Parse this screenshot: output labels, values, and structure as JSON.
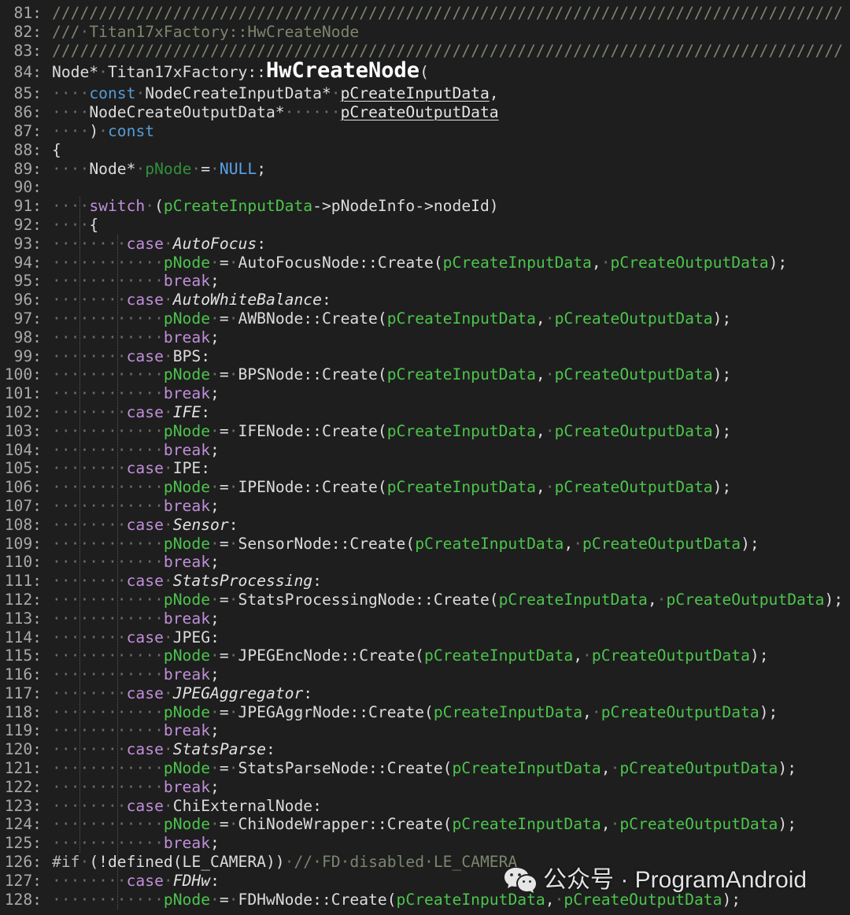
{
  "editor": {
    "syntax_colors": {
      "background": "#1e1e1e",
      "text": "#dcdcdc",
      "line_number": "#a9a9a9",
      "ws": "#6c6c6c",
      "comment": "#7a866e",
      "kw": "#569cd6",
      "ctl": "#c08fd8",
      "nul": "#5aa2ea",
      "txt": "#dcdcdc",
      "par": "#4cc44c",
      "loc": "#32903c",
      "enum": "#e2e2e2",
      "func": "#ffffff",
      "decl": "#e4e4e4",
      "pre": "#b8b8b8"
    },
    "lines": [
      {
        "n": "81:",
        "tokens": [
          {
            "comment": "/////////////////////////////////////////////////////////////////////////////////////"
          }
        ]
      },
      {
        "n": "82:",
        "tokens": [
          {
            "comment": "///"
          },
          {
            "ws": "·"
          },
          {
            "comment": "Titan17xFactory::HwCreateNode"
          }
        ]
      },
      {
        "n": "83:",
        "tokens": [
          {
            "comment": "/////////////////////////////////////////////////////////////////////////////////////"
          }
        ]
      },
      {
        "n": "84:",
        "tokens": [
          {
            "txt": "Node*"
          },
          {
            "ws": "·"
          },
          {
            "txt": "Titan17xFactory::"
          },
          {
            "func": "HwCreateNode"
          },
          {
            "txt": "("
          }
        ]
      },
      {
        "n": "85:",
        "tokens": [
          {
            "ws": "····"
          },
          {
            "kw": "const"
          },
          {
            "ws": "·"
          },
          {
            "txt": "NodeCreateInputData*"
          },
          {
            "ws": "·"
          },
          {
            "decl": "pCreateInputData"
          },
          {
            "txt": ","
          }
        ]
      },
      {
        "n": "86:",
        "tokens": [
          {
            "ws": "····"
          },
          {
            "txt": "NodeCreateOutputData*"
          },
          {
            "ws": "······"
          },
          {
            "decl": "pCreateOutputData"
          }
        ]
      },
      {
        "n": "87:",
        "tokens": [
          {
            "ws": "····"
          },
          {
            "txt": ")"
          },
          {
            "ws": "·"
          },
          {
            "kw": "const"
          }
        ]
      },
      {
        "n": "88:",
        "tokens": [
          {
            "txt": "{"
          }
        ]
      },
      {
        "n": "89:",
        "tokens": [
          {
            "ws": "····"
          },
          {
            "txt": "Node*"
          },
          {
            "ws": "·"
          },
          {
            "loc": "pNode"
          },
          {
            "ws": "·"
          },
          {
            "txt": "="
          },
          {
            "ws": "·"
          },
          {
            "nul": "NULL"
          },
          {
            "txt": ";"
          }
        ]
      },
      {
        "n": "90:",
        "tokens": []
      },
      {
        "n": "91:",
        "tokens": [
          {
            "ws": "····"
          },
          {
            "ctl": "switch"
          },
          {
            "ws": "·"
          },
          {
            "txt": "("
          },
          {
            "par": "pCreateInputData"
          },
          {
            "txt": "->pNodeInfo->nodeId)"
          }
        ]
      },
      {
        "n": "92:",
        "tokens": [
          {
            "ws": "····"
          },
          {
            "txt": "{"
          }
        ]
      },
      {
        "n": "93:",
        "tokens": [
          {
            "ws": "········"
          },
          {
            "ctl": "case"
          },
          {
            "ws": "·"
          },
          {
            "enum": "AutoFocus"
          },
          {
            "txt": ":"
          }
        ]
      },
      {
        "n": "94:",
        "tokens": [
          {
            "ws": "············"
          },
          {
            "par": "pNode"
          },
          {
            "ws": "·"
          },
          {
            "txt": "="
          },
          {
            "ws": "·"
          },
          {
            "txt": "AutoFocusNode::Create("
          },
          {
            "par": "pCreateInputData"
          },
          {
            "txt": ","
          },
          {
            "ws": "·"
          },
          {
            "par": "pCreateOutputData"
          },
          {
            "txt": ");"
          }
        ]
      },
      {
        "n": "95:",
        "tokens": [
          {
            "ws": "············"
          },
          {
            "ctl": "break"
          },
          {
            "txt": ";"
          }
        ]
      },
      {
        "n": "96:",
        "tokens": [
          {
            "ws": "········"
          },
          {
            "ctl": "case"
          },
          {
            "ws": "·"
          },
          {
            "enum": "AutoWhiteBalance"
          },
          {
            "txt": ":"
          }
        ]
      },
      {
        "n": "97:",
        "tokens": [
          {
            "ws": "············"
          },
          {
            "par": "pNode"
          },
          {
            "ws": "·"
          },
          {
            "txt": "="
          },
          {
            "ws": "·"
          },
          {
            "txt": "AWBNode::Create("
          },
          {
            "par": "pCreateInputData"
          },
          {
            "txt": ","
          },
          {
            "ws": "·"
          },
          {
            "par": "pCreateOutputData"
          },
          {
            "txt": ");"
          }
        ]
      },
      {
        "n": "98:",
        "tokens": [
          {
            "ws": "············"
          },
          {
            "ctl": "break"
          },
          {
            "txt": ";"
          }
        ]
      },
      {
        "n": "99:",
        "tokens": [
          {
            "ws": "········"
          },
          {
            "ctl": "case"
          },
          {
            "ws": "·"
          },
          {
            "txt": "BPS"
          },
          {
            "txt": ":"
          }
        ]
      },
      {
        "n": "100:",
        "tokens": [
          {
            "ws": "············"
          },
          {
            "par": "pNode"
          },
          {
            "ws": "·"
          },
          {
            "txt": "="
          },
          {
            "ws": "·"
          },
          {
            "txt": "BPSNode::Create("
          },
          {
            "par": "pCreateInputData"
          },
          {
            "txt": ","
          },
          {
            "ws": "·"
          },
          {
            "par": "pCreateOutputData"
          },
          {
            "txt": ");"
          }
        ]
      },
      {
        "n": "101:",
        "tokens": [
          {
            "ws": "············"
          },
          {
            "ctl": "break"
          },
          {
            "txt": ";"
          }
        ]
      },
      {
        "n": "102:",
        "tokens": [
          {
            "ws": "········"
          },
          {
            "ctl": "case"
          },
          {
            "ws": "·"
          },
          {
            "enum": "IFE"
          },
          {
            "txt": ":"
          }
        ]
      },
      {
        "n": "103:",
        "tokens": [
          {
            "ws": "············"
          },
          {
            "par": "pNode"
          },
          {
            "ws": "·"
          },
          {
            "txt": "="
          },
          {
            "ws": "·"
          },
          {
            "txt": "IFENode::Create("
          },
          {
            "par": "pCreateInputData"
          },
          {
            "txt": ","
          },
          {
            "ws": "·"
          },
          {
            "par": "pCreateOutputData"
          },
          {
            "txt": ");"
          }
        ]
      },
      {
        "n": "104:",
        "tokens": [
          {
            "ws": "············"
          },
          {
            "ctl": "break"
          },
          {
            "txt": ";"
          }
        ]
      },
      {
        "n": "105:",
        "tokens": [
          {
            "ws": "········"
          },
          {
            "ctl": "case"
          },
          {
            "ws": "·"
          },
          {
            "txt": "IPE"
          },
          {
            "txt": ":"
          }
        ]
      },
      {
        "n": "106:",
        "tokens": [
          {
            "ws": "············"
          },
          {
            "par": "pNode"
          },
          {
            "ws": "·"
          },
          {
            "txt": "="
          },
          {
            "ws": "·"
          },
          {
            "txt": "IPENode::Create("
          },
          {
            "par": "pCreateInputData"
          },
          {
            "txt": ","
          },
          {
            "ws": "·"
          },
          {
            "par": "pCreateOutputData"
          },
          {
            "txt": ");"
          }
        ]
      },
      {
        "n": "107:",
        "tokens": [
          {
            "ws": "············"
          },
          {
            "ctl": "break"
          },
          {
            "txt": ";"
          }
        ]
      },
      {
        "n": "108:",
        "tokens": [
          {
            "ws": "········"
          },
          {
            "ctl": "case"
          },
          {
            "ws": "·"
          },
          {
            "enum": "Sensor"
          },
          {
            "txt": ":"
          }
        ]
      },
      {
        "n": "109:",
        "tokens": [
          {
            "ws": "············"
          },
          {
            "par": "pNode"
          },
          {
            "ws": "·"
          },
          {
            "txt": "="
          },
          {
            "ws": "·"
          },
          {
            "txt": "SensorNode::Create("
          },
          {
            "par": "pCreateInputData"
          },
          {
            "txt": ","
          },
          {
            "ws": "·"
          },
          {
            "par": "pCreateOutputData"
          },
          {
            "txt": ");"
          }
        ]
      },
      {
        "n": "110:",
        "tokens": [
          {
            "ws": "············"
          },
          {
            "ctl": "break"
          },
          {
            "txt": ";"
          }
        ]
      },
      {
        "n": "111:",
        "tokens": [
          {
            "ws": "········"
          },
          {
            "ctl": "case"
          },
          {
            "ws": "·"
          },
          {
            "enum": "StatsProcessing"
          },
          {
            "txt": ":"
          }
        ]
      },
      {
        "n": "112:",
        "tokens": [
          {
            "ws": "············"
          },
          {
            "par": "pNode"
          },
          {
            "ws": "·"
          },
          {
            "txt": "="
          },
          {
            "ws": "·"
          },
          {
            "txt": "StatsProcessingNode::Create("
          },
          {
            "par": "pCreateInputData"
          },
          {
            "txt": ","
          },
          {
            "ws": "·"
          },
          {
            "par": "pCreateOutputData"
          },
          {
            "txt": ");"
          }
        ]
      },
      {
        "n": "113:",
        "tokens": [
          {
            "ws": "············"
          },
          {
            "ctl": "break"
          },
          {
            "txt": ";"
          }
        ]
      },
      {
        "n": "114:",
        "tokens": [
          {
            "ws": "········"
          },
          {
            "ctl": "case"
          },
          {
            "ws": "·"
          },
          {
            "txt": "JPEG"
          },
          {
            "txt": ":"
          }
        ]
      },
      {
        "n": "115:",
        "tokens": [
          {
            "ws": "············"
          },
          {
            "par": "pNode"
          },
          {
            "ws": "·"
          },
          {
            "txt": "="
          },
          {
            "ws": "·"
          },
          {
            "txt": "JPEGEncNode::Create("
          },
          {
            "par": "pCreateInputData"
          },
          {
            "txt": ","
          },
          {
            "ws": "·"
          },
          {
            "par": "pCreateOutputData"
          },
          {
            "txt": ");"
          }
        ]
      },
      {
        "n": "116:",
        "tokens": [
          {
            "ws": "············"
          },
          {
            "ctl": "break"
          },
          {
            "txt": ";"
          }
        ]
      },
      {
        "n": "117:",
        "tokens": [
          {
            "ws": "········"
          },
          {
            "ctl": "case"
          },
          {
            "ws": "·"
          },
          {
            "enum": "JPEGAggregator"
          },
          {
            "txt": ":"
          }
        ]
      },
      {
        "n": "118:",
        "tokens": [
          {
            "ws": "············"
          },
          {
            "par": "pNode"
          },
          {
            "ws": "·"
          },
          {
            "txt": "="
          },
          {
            "ws": "·"
          },
          {
            "txt": "JPEGAggrNode::Create("
          },
          {
            "par": "pCreateInputData"
          },
          {
            "txt": ","
          },
          {
            "ws": "·"
          },
          {
            "par": "pCreateOutputData"
          },
          {
            "txt": ");"
          }
        ]
      },
      {
        "n": "119:",
        "tokens": [
          {
            "ws": "············"
          },
          {
            "ctl": "break"
          },
          {
            "txt": ";"
          }
        ]
      },
      {
        "n": "120:",
        "tokens": [
          {
            "ws": "········"
          },
          {
            "ctl": "case"
          },
          {
            "ws": "·"
          },
          {
            "enum": "StatsParse"
          },
          {
            "txt": ":"
          }
        ]
      },
      {
        "n": "121:",
        "tokens": [
          {
            "ws": "············"
          },
          {
            "par": "pNode"
          },
          {
            "ws": "·"
          },
          {
            "txt": "="
          },
          {
            "ws": "·"
          },
          {
            "txt": "StatsParseNode::Create("
          },
          {
            "par": "pCreateInputData"
          },
          {
            "txt": ","
          },
          {
            "ws": "·"
          },
          {
            "par": "pCreateOutputData"
          },
          {
            "txt": ");"
          }
        ]
      },
      {
        "n": "122:",
        "tokens": [
          {
            "ws": "············"
          },
          {
            "ctl": "break"
          },
          {
            "txt": ";"
          }
        ]
      },
      {
        "n": "123:",
        "tokens": [
          {
            "ws": "········"
          },
          {
            "ctl": "case"
          },
          {
            "ws": "·"
          },
          {
            "txt": "ChiExternalNode"
          },
          {
            "txt": ":"
          }
        ]
      },
      {
        "n": "124:",
        "tokens": [
          {
            "ws": "············"
          },
          {
            "par": "pNode"
          },
          {
            "ws": "·"
          },
          {
            "txt": "="
          },
          {
            "ws": "·"
          },
          {
            "txt": "ChiNodeWrapper::Create("
          },
          {
            "par": "pCreateInputData"
          },
          {
            "txt": ","
          },
          {
            "ws": "·"
          },
          {
            "par": "pCreateOutputData"
          },
          {
            "txt": ");"
          }
        ]
      },
      {
        "n": "125:",
        "tokens": [
          {
            "ws": "············"
          },
          {
            "ctl": "break"
          },
          {
            "txt": ";"
          }
        ]
      },
      {
        "n": "126:",
        "tokens": [
          {
            "pre": "#if"
          },
          {
            "ws": "·"
          },
          {
            "txt": "(!defined(LE_CAMERA))"
          },
          {
            "ws": "·"
          },
          {
            "comment": "//·FD·disabled·LE_CAMERA"
          }
        ]
      },
      {
        "n": "127:",
        "tokens": [
          {
            "ws": "········"
          },
          {
            "ctl": "case"
          },
          {
            "ws": "·"
          },
          {
            "enum": "FDHw"
          },
          {
            "txt": ":"
          }
        ]
      },
      {
        "n": "128:",
        "tokens": [
          {
            "ws": "············"
          },
          {
            "par": "pNode"
          },
          {
            "ws": "·"
          },
          {
            "txt": "="
          },
          {
            "ws": "·"
          },
          {
            "txt": "FDHwNode::Create("
          },
          {
            "par": "pCreateInputData"
          },
          {
            "txt": ","
          },
          {
            "ws": "·"
          },
          {
            "par": "pCreateOutputData"
          },
          {
            "txt": ");"
          }
        ]
      }
    ]
  },
  "watermark": {
    "icon": "wechat-icon",
    "color": "#e2e2e2",
    "text": "公众号 · ProgramAndroid"
  }
}
